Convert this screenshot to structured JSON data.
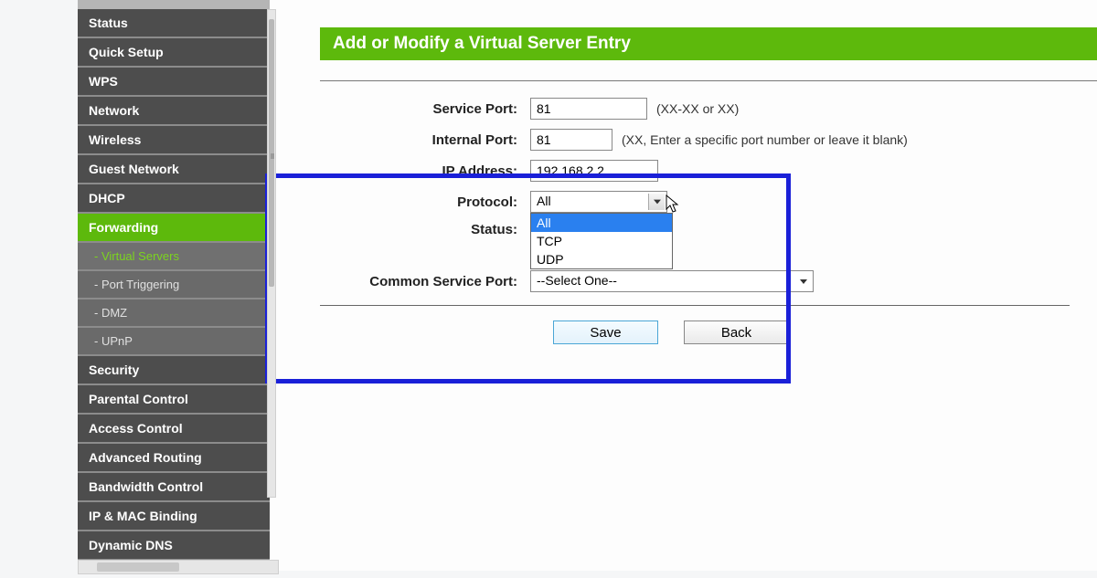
{
  "sidebar": {
    "items": [
      {
        "label": "Status",
        "type": "item"
      },
      {
        "label": "Quick Setup",
        "type": "item"
      },
      {
        "label": "WPS",
        "type": "item"
      },
      {
        "label": "Network",
        "type": "item"
      },
      {
        "label": "Wireless",
        "type": "item"
      },
      {
        "label": "Guest Network",
        "type": "item"
      },
      {
        "label": "DHCP",
        "type": "item"
      },
      {
        "label": "Forwarding",
        "type": "item-active"
      },
      {
        "label": "- Virtual Servers",
        "type": "sub-active"
      },
      {
        "label": "- Port Triggering",
        "type": "sub"
      },
      {
        "label": "- DMZ",
        "type": "sub"
      },
      {
        "label": "- UPnP",
        "type": "sub"
      },
      {
        "label": "Security",
        "type": "item"
      },
      {
        "label": "Parental Control",
        "type": "item"
      },
      {
        "label": "Access Control",
        "type": "item"
      },
      {
        "label": "Advanced Routing",
        "type": "item"
      },
      {
        "label": "Bandwidth Control",
        "type": "item"
      },
      {
        "label": "IP & MAC Binding",
        "type": "item"
      },
      {
        "label": "Dynamic DNS",
        "type": "item"
      }
    ]
  },
  "page": {
    "title": "Add or Modify a Virtual Server Entry"
  },
  "form": {
    "service_port": {
      "label": "Service Port:",
      "value": "81",
      "hint": "(XX-XX or XX)"
    },
    "internal_port": {
      "label": "Internal Port:",
      "value": "81",
      "hint": "(XX, Enter a specific port number or leave it blank)"
    },
    "ip_address": {
      "label": "IP Address:",
      "value": "192.168.2.2"
    },
    "protocol": {
      "label": "Protocol:",
      "selected": "All",
      "options": [
        "All",
        "TCP",
        "UDP"
      ]
    },
    "status": {
      "label": "Status:"
    },
    "common_service_port": {
      "label": "Common Service Port:",
      "selected": "--Select One--"
    }
  },
  "buttons": {
    "save": "Save",
    "back": "Back"
  }
}
